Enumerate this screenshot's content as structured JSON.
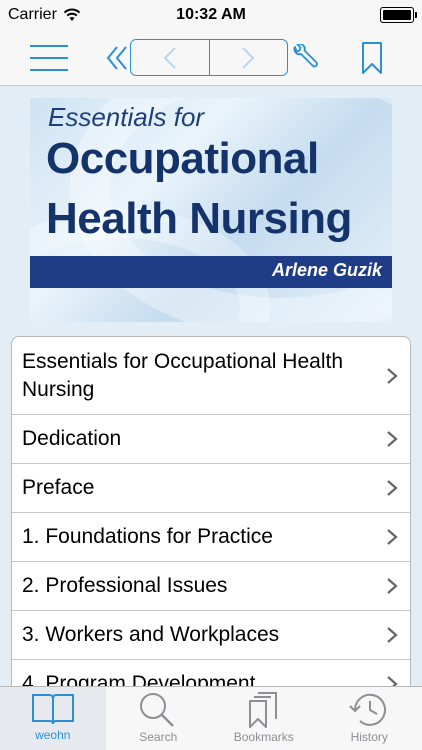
{
  "status_bar": {
    "carrier": "Carrier",
    "time": "10:32 AM"
  },
  "toolbar": {
    "icons": [
      "menu-icon",
      "double-chevron-left-icon",
      "back-arrow-icon",
      "forward-arrow-icon",
      "wrench-icon",
      "bookmark-icon"
    ]
  },
  "cover": {
    "essentials": "Essentials for",
    "title_line1": "Occupational",
    "title_line2": "Health Nursing",
    "author": "Arlene Guzik"
  },
  "toc": {
    "items": [
      "Essentials for Occupational Health Nursing",
      "Dedication",
      "Preface",
      "1. Foundations for Practice",
      "2. Professional Issues",
      "3. Workers and Workplaces",
      "4. Program Development"
    ]
  },
  "tabbar": {
    "tabs": [
      {
        "label": "weohn",
        "icon": "book-icon"
      },
      {
        "label": "Search",
        "icon": "search-icon"
      },
      {
        "label": "Bookmarks",
        "icon": "bookmarks-icon"
      },
      {
        "label": "History",
        "icon": "history-icon"
      }
    ]
  },
  "colors": {
    "accent": "#2b8fd6",
    "cover_band": "#1f3c87",
    "background": "#e3edf6"
  }
}
